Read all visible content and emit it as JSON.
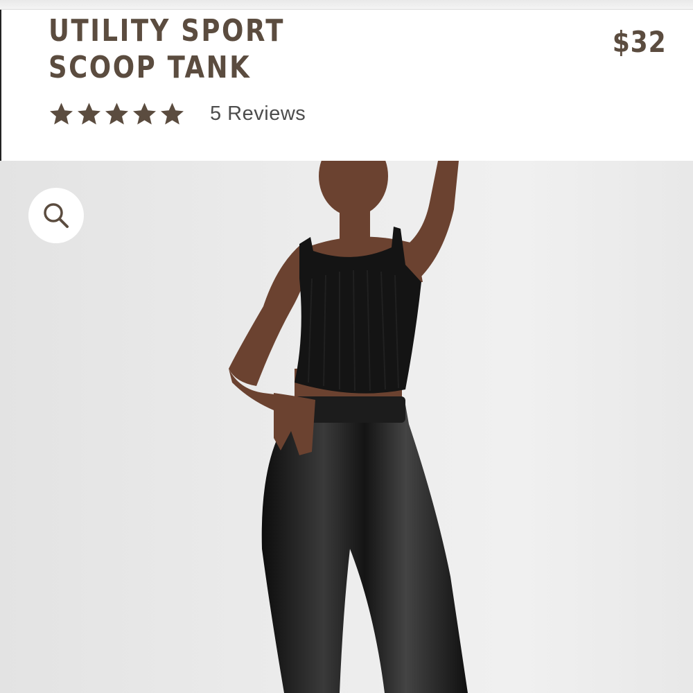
{
  "product": {
    "title": "UTILITY SPORT SCOOP TANK",
    "price": "$32",
    "rating": 5,
    "rating_max": 5,
    "reviews_label": "5 Reviews"
  },
  "icons": {
    "star": "star-icon",
    "zoom": "search-icon"
  },
  "colors": {
    "title_text": "#5b4c3f",
    "star_fill": "#5b4c3f",
    "review_text": "#4c4c4c",
    "gallery_bg": "#ececec"
  }
}
